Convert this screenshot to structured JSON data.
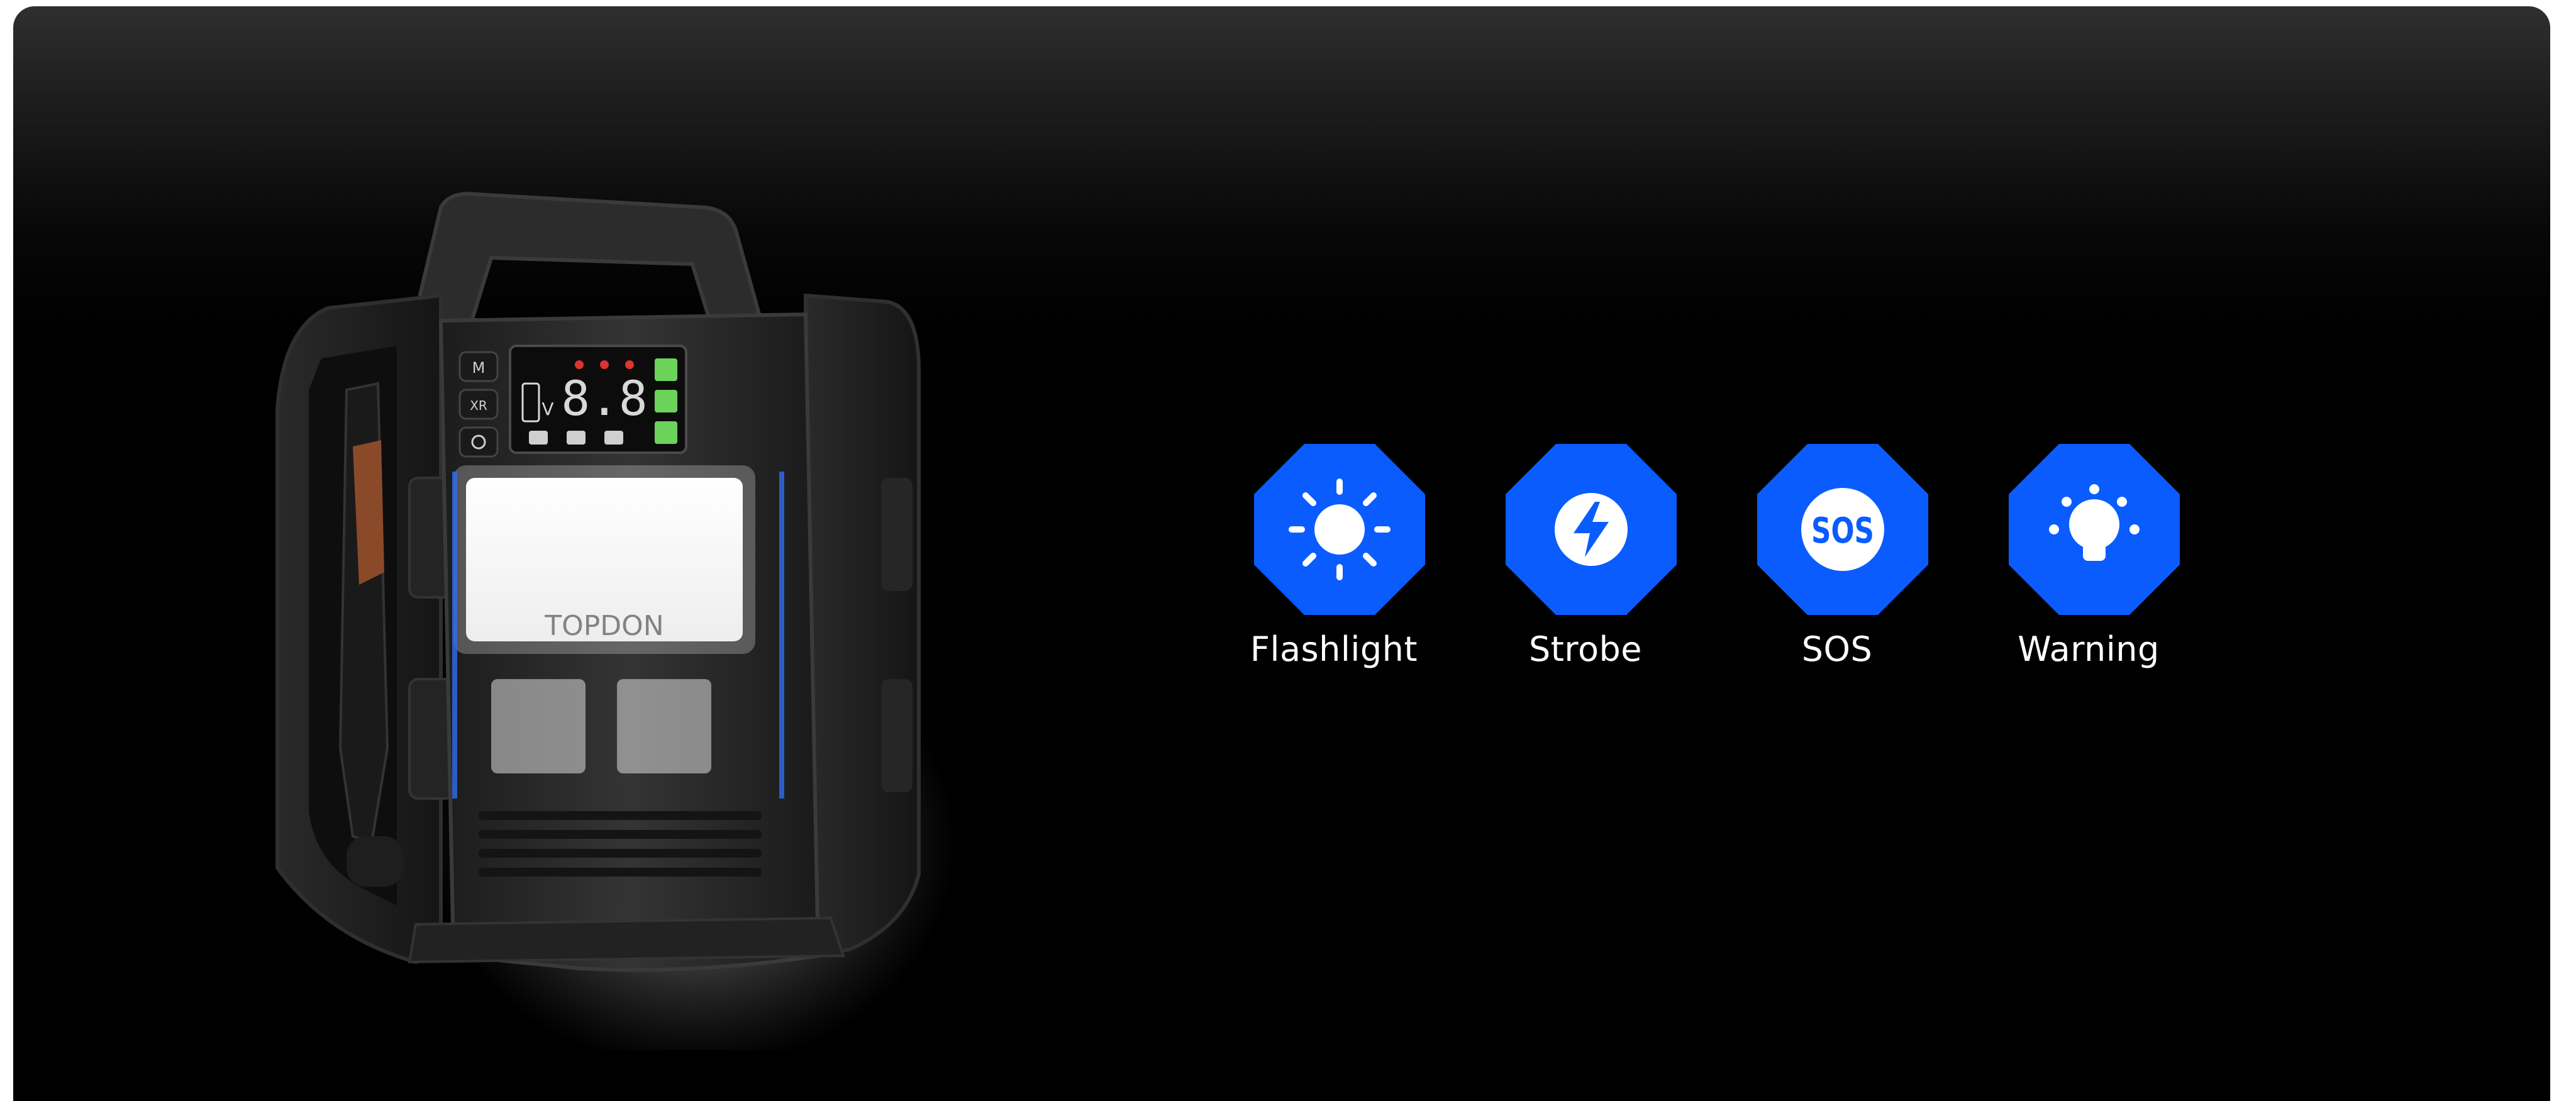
{
  "page": {
    "background_color": "#000000",
    "accent_color": "#0a5cff"
  },
  "product": {
    "image_name": "jump-starter-with-flashlight",
    "brand_text": "TOPDON",
    "display_readout": "8.8",
    "display_unit": "V",
    "button_labels": [
      "M",
      "XR"
    ]
  },
  "light_modes": [
    {
      "label": "Flashlight",
      "icon": "sun-icon"
    },
    {
      "label": "Strobe",
      "icon": "lightning-bolt-icon"
    },
    {
      "label": "SOS",
      "icon": "sos-icon",
      "icon_text": "SOS"
    },
    {
      "label": "Warning",
      "icon": "lightbulb-icon"
    }
  ]
}
